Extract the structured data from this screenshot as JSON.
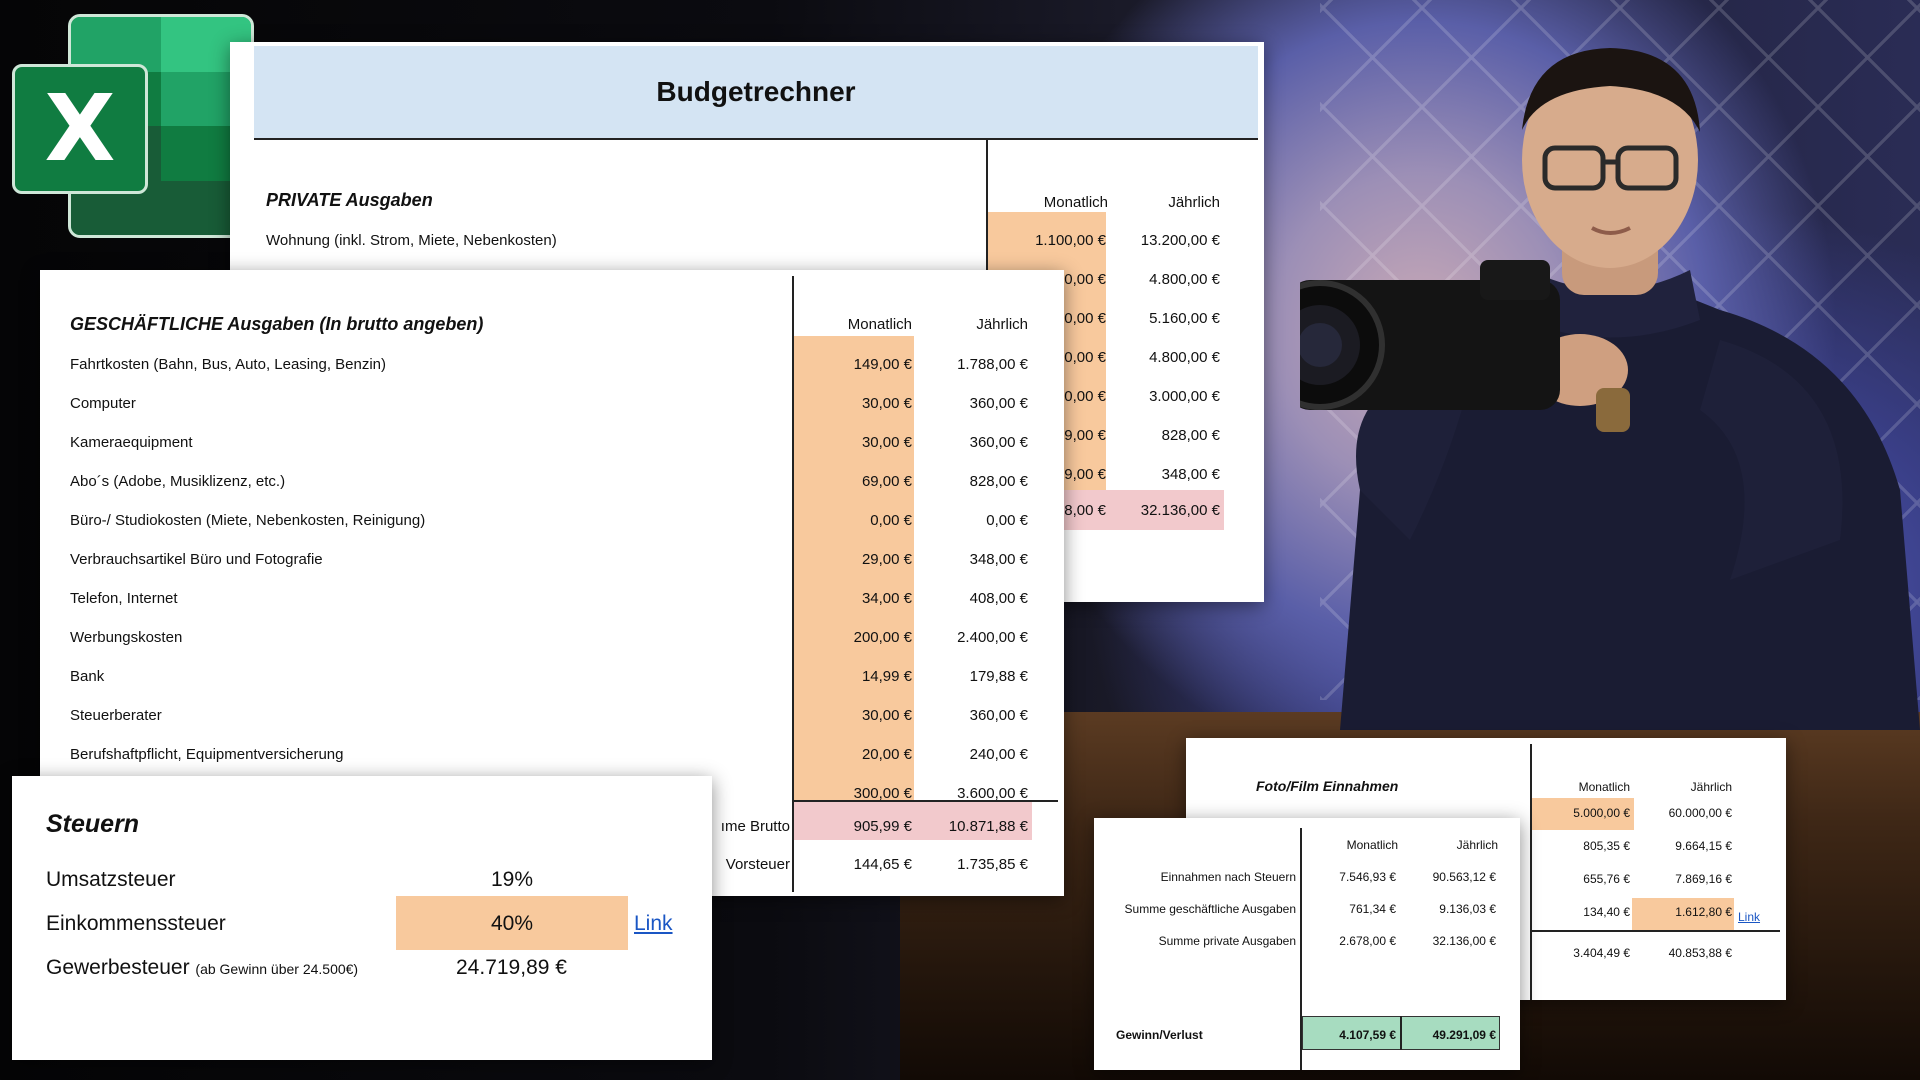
{
  "colors": {
    "orange_cell": "#f8c99d",
    "pink_cell": "#f2c9cc",
    "green_cell": "#a7dcc0",
    "title_band": "#d4e4f3",
    "link": "#1a56c4",
    "excel_green": "#107c41"
  },
  "logo": {
    "letter": "X",
    "icon": "excel-logo-icon"
  },
  "budget": {
    "title": "Budgetrechner",
    "private": {
      "heading": "PRIVATE Ausgaben",
      "first_item": "Wohnung (inkl. Strom, Miete, Nebenkosten)",
      "col_monthly": "Monatlich",
      "col_yearly": "Jährlich",
      "monthly": [
        "1.100,00 €",
        "0,00 €",
        "0,00 €",
        "0,00 €",
        "0,00 €",
        "9,00 €",
        "9,00 €"
      ],
      "yearly": [
        "13.200,00 €",
        "4.800,00 €",
        "5.160,00 €",
        "4.800,00 €",
        "3.000,00 €",
        "828,00 €",
        "348,00 €"
      ],
      "sum_monthly_partial": "8,00 €",
      "sum_yearly": "32.136,00 €"
    }
  },
  "business": {
    "heading": "GESCHÄFTLICHE Ausgaben (In brutto angeben)",
    "col_monthly": "Monatlich",
    "col_yearly": "Jährlich",
    "rows": [
      {
        "label": "Fahrtkosten (Bahn, Bus, Auto, Leasing, Benzin)",
        "monthly": "149,00 €",
        "yearly": "1.788,00 €"
      },
      {
        "label": "Computer",
        "monthly": "30,00 €",
        "yearly": "360,00 €"
      },
      {
        "label": "Kameraequipment",
        "monthly": "30,00 €",
        "yearly": "360,00 €"
      },
      {
        "label": "Abo´s  (Adobe, Musiklizenz, etc.)",
        "monthly": "69,00 €",
        "yearly": "828,00 €"
      },
      {
        "label": "Büro-/ Studiokosten (Miete, Nebenkosten, Reinigung)",
        "monthly": "0,00 €",
        "yearly": "0,00 €"
      },
      {
        "label": "Verbrauchsartikel Büro und Fotografie",
        "monthly": "29,00 €",
        "yearly": "348,00 €"
      },
      {
        "label": "Telefon, Internet",
        "monthly": "34,00 €",
        "yearly": "408,00 €"
      },
      {
        "label": "Werbungskosten",
        "monthly": "200,00 €",
        "yearly": "2.400,00 €"
      },
      {
        "label": "Bank",
        "monthly": "14,99 €",
        "yearly": "179,88 €"
      },
      {
        "label": "Steuerberater",
        "monthly": "30,00 €",
        "yearly": "360,00 €"
      },
      {
        "label": "Berufshaftpflicht, Equipmentversicherung",
        "monthly": "20,00 €",
        "yearly": "240,00 €"
      },
      {
        "label": "",
        "monthly": "300,00 €",
        "yearly": "3.600,00 €"
      }
    ],
    "sum_label_partial": "ıme Brutto",
    "sum_monthly": "905,99 €",
    "sum_yearly": "10.871,88 €",
    "vat_label_partial": "Vorsteuer",
    "vat_monthly": "144,65 €",
    "vat_yearly": "1.735,85 €"
  },
  "taxes": {
    "heading": "Steuern",
    "vat_label": "Umsatzsteuer",
    "vat_value": "19%",
    "income_label": "Einkommenssteuer",
    "income_value": "40%",
    "link": "Link",
    "trade_label": "Gewerbesteuer",
    "trade_note": "(ab Gewinn über 24.500€)",
    "trade_value": "24.719,89 €"
  },
  "income": {
    "heading": "Foto/Film Einnahmen",
    "col_monthly": "Monatlich",
    "col_yearly": "Jährlich",
    "monthly": [
      "5.000,00 €",
      "805,35 €",
      "655,76 €",
      "134,40 €",
      "3.404,49 €"
    ],
    "yearly": [
      "60.000,00 €",
      "9.664,15 €",
      "7.869,16 €",
      "1.612,80 €",
      "40.853,88 €"
    ],
    "link": "Link"
  },
  "summary": {
    "col_monthly": "Monatlich",
    "col_yearly": "Jährlich",
    "rows": [
      {
        "label": "Einnahmen nach Steuern",
        "monthly": "7.546,93 €",
        "yearly": "90.563,12 €"
      },
      {
        "label": "Summe geschäftliche Ausgaben",
        "monthly": "761,34 €",
        "yearly": "9.136,03 €"
      },
      {
        "label": "Summe private Ausgaben",
        "monthly": "2.678,00 €",
        "yearly": "32.136,00 €"
      }
    ],
    "result_label": "Gewinn/Verlust",
    "result_monthly": "4.107,59 €",
    "result_yearly": "49.291,09 €"
  }
}
